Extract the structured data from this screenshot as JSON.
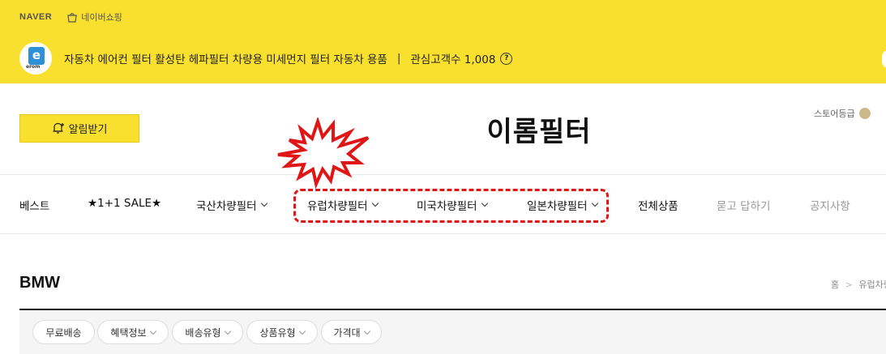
{
  "header": {
    "naver_logo": "NAVER",
    "naver_shopping": "네이버쇼핑",
    "store_logo_text": "e",
    "store_logo_sub": "erom",
    "store_description": "자동차 에어컨 필터 활성탄 헤파필터 차량용 미세먼지 필터 자동차 용품",
    "separator": "|",
    "interest_label": "관심고객수 1,008",
    "help_icon": "?"
  },
  "alarm_button": "알림받기",
  "store_title": "이롬필터",
  "store_grade_label": "스토어등급",
  "nav": {
    "items": [
      {
        "label": "베스트",
        "chevron": false,
        "muted": false
      },
      {
        "label": "★1+1 SALE★",
        "chevron": false,
        "muted": false
      },
      {
        "label": "국산차량필터",
        "chevron": true,
        "muted": false
      },
      {
        "label": "유럽차량필터",
        "chevron": true,
        "muted": false
      },
      {
        "label": "미국차량필터",
        "chevron": true,
        "muted": false
      },
      {
        "label": "일본차량필터",
        "chevron": true,
        "muted": false
      },
      {
        "label": "전체상품",
        "chevron": false,
        "muted": false
      },
      {
        "label": "묻고 답하기",
        "chevron": false,
        "muted": true
      },
      {
        "label": "공지사항",
        "chevron": false,
        "muted": true
      }
    ]
  },
  "category": {
    "title": "BMW",
    "breadcrumb_home": "홈",
    "breadcrumb_sep": ">",
    "breadcrumb_current": "유럽차량"
  },
  "filters": [
    {
      "label": "무료배송",
      "chevron": false
    },
    {
      "label": "혜택정보",
      "chevron": true
    },
    {
      "label": "배송유형",
      "chevron": true
    },
    {
      "label": "상품유형",
      "chevron": true
    },
    {
      "label": "가격대",
      "chevron": true
    }
  ],
  "colors": {
    "brand_yellow": "#f9df2e",
    "highlight_red": "#e01515"
  }
}
